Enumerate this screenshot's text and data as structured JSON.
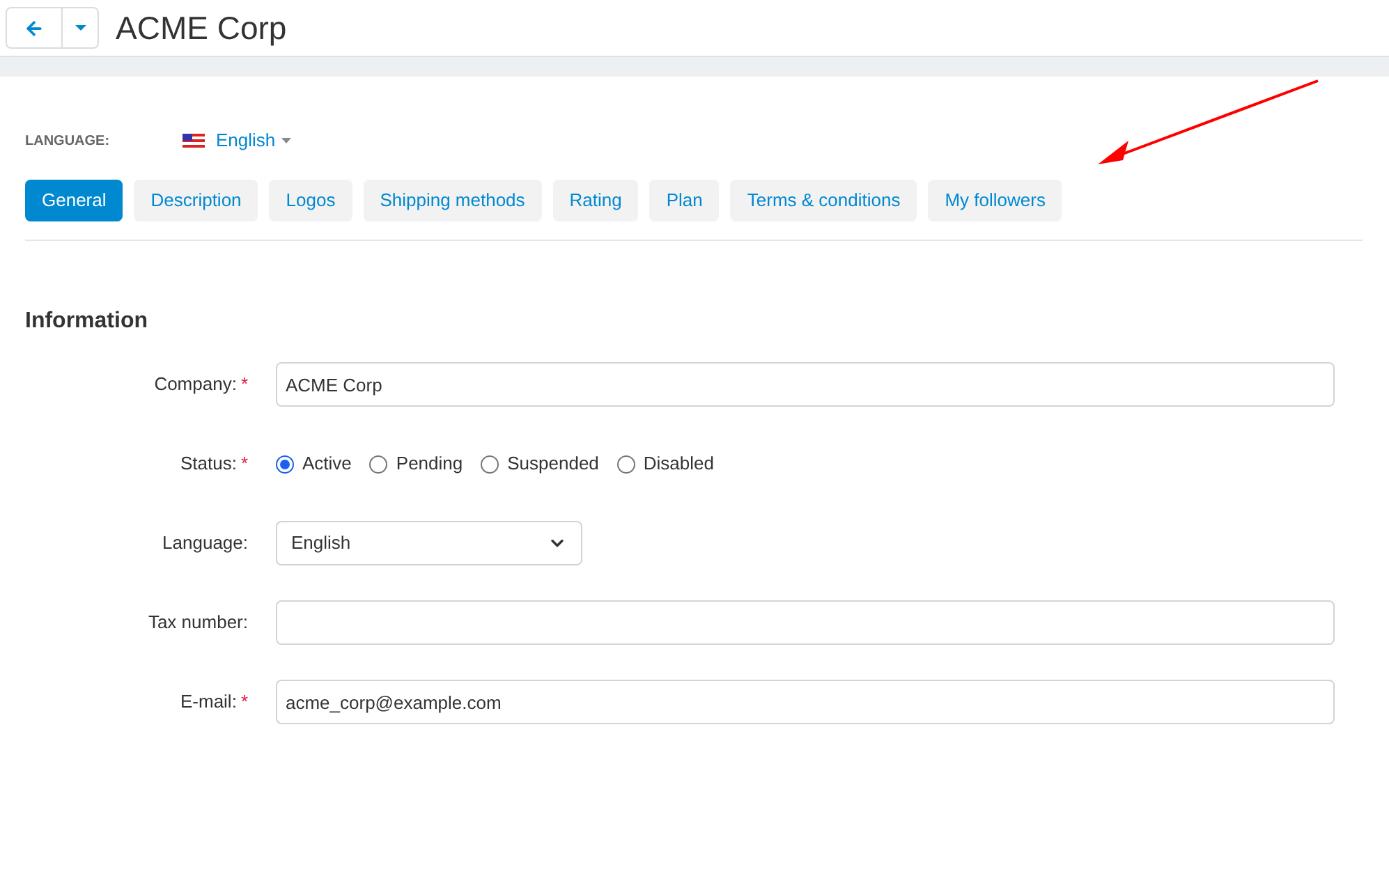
{
  "header": {
    "title": "ACME Corp"
  },
  "language_switcher": {
    "label": "LANGUAGE:",
    "value": "English"
  },
  "tabs": [
    {
      "label": "General",
      "selected": true
    },
    {
      "label": "Description",
      "selected": false
    },
    {
      "label": "Logos",
      "selected": false
    },
    {
      "label": "Shipping methods",
      "selected": false
    },
    {
      "label": "Rating",
      "selected": false
    },
    {
      "label": "Plan",
      "selected": false
    },
    {
      "label": "Terms & conditions",
      "selected": false
    },
    {
      "label": "My followers",
      "selected": false
    }
  ],
  "section": {
    "title": "Information"
  },
  "fields": [
    {
      "kind": "text",
      "label": "Company:",
      "required_mark": "*",
      "value": "ACME Corp"
    },
    {
      "kind": "radio",
      "label": "Status:",
      "required_mark": "*",
      "options": [
        {
          "label": "Active",
          "selected": true
        },
        {
          "label": "Pending",
          "selected": false
        },
        {
          "label": "Suspended",
          "selected": false
        },
        {
          "label": "Disabled",
          "selected": false
        }
      ]
    },
    {
      "kind": "select",
      "label": "Language:",
      "value": "English"
    },
    {
      "kind": "text",
      "label": "Tax number:"
    },
    {
      "kind": "text",
      "label": "E-mail:",
      "required_mark": "*",
      "value": "acme_corp@example.com"
    }
  ]
}
